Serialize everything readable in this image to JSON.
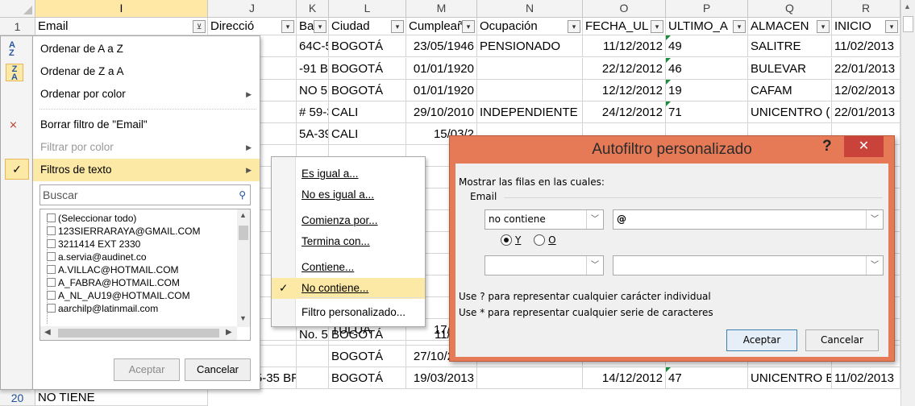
{
  "sheet": {
    "columns": [
      "I",
      "J",
      "K",
      "L",
      "M",
      "N",
      "O",
      "P",
      "Q",
      "R"
    ],
    "selected_column": "I",
    "header_row": {
      "num": "1",
      "cells": [
        "Email",
        "Direcció",
        "Barr",
        "Ciudad",
        "Cumpleañ",
        "Ocupación",
        "FECHA_UL",
        "ULTIMO_A",
        "ALMACEN",
        "INICIO"
      ]
    },
    "rows": [
      {
        "j": "",
        "k": "64C-50 BR",
        "l": "BOGOTÁ",
        "m": "23/05/1946",
        "n": "PENSIONADO",
        "o": "11/12/2012",
        "p": "49",
        "q": "SALITRE",
        "r": "11/02/2013"
      },
      {
        "j": "",
        "k": "-91 BLOC",
        "l": "BOGOTÁ",
        "m": "01/01/1920",
        "n": "",
        "o": "22/12/2012",
        "p": "46",
        "q": "BULEVAR",
        "r": "22/01/2013"
      },
      {
        "j": "",
        "k": "NO 51-45",
        "l": "BOGOTÁ",
        "m": "01/01/1920",
        "n": "",
        "o": "12/12/2012",
        "p": "19",
        "q": "CAFAM",
        "r": "12/02/2013"
      },
      {
        "j": "",
        "k": "# 59-31 bri",
        "l": "CALI",
        "m": "29/10/2010",
        "n": "INDEPENDIENTE",
        "o": "24/12/2012",
        "p": "71",
        "q": "UNICENTRO (",
        "r": "22/01/2013"
      },
      {
        "j": "",
        "k": "5A-39  BRI",
        "l": "CALI",
        "m": "15/03/2",
        "n": "",
        "o": "",
        "p": "",
        "q": "",
        "r": ""
      },
      {
        "j": "",
        "k": "",
        "l": "",
        "m": "05/2",
        "n": "",
        "o": "",
        "p": "",
        "q": "",
        "r": ""
      },
      {
        "j": "",
        "k": "",
        "l": "",
        "m": "07/0",
        "n": "",
        "o": "",
        "p": "",
        "q": "",
        "r": ""
      },
      {
        "j": "",
        "k": "",
        "l": "",
        "m": "05/1",
        "n": "",
        "o": "",
        "p": "",
        "q": "",
        "r": ""
      },
      {
        "j": "",
        "k": "",
        "l": "",
        "m": "08/2",
        "n": "",
        "o": "",
        "p": "",
        "q": "",
        "r": ""
      },
      {
        "j": "",
        "k": "",
        "l": "",
        "m": "07/2",
        "n": "",
        "o": "",
        "p": "",
        "q": "",
        "r": ""
      },
      {
        "j": "",
        "k": "",
        "l": "",
        "m": "01/2",
        "n": "",
        "o": "",
        "p": "",
        "q": "",
        "r": ""
      },
      {
        "j": "",
        "k": "",
        "l": "",
        "m": "05/2",
        "n": "",
        "o": "",
        "p": "",
        "q": "",
        "r": ""
      },
      {
        "j": "",
        "k": "",
        "l": "",
        "m": "12/1",
        "n": "",
        "o": "",
        "p": "",
        "q": "",
        "r": ""
      },
      {
        "j": "",
        "k": "",
        "l": "TULUA",
        "m": "17/12/1",
        "n": "",
        "o": "",
        "p": "",
        "q": "",
        "r": ""
      },
      {
        "j": "",
        "k": "No. 57-71",
        "l": "BOGOTÁ",
        "m": "11/12/2",
        "n": "",
        "o": "",
        "p": "",
        "q": "",
        "r": ""
      },
      {
        "j": "",
        "k": "",
        "l": "BOGOTÁ",
        "m": "27/10/2013",
        "n": "",
        "o": "22/12/2012",
        "p": "47",
        "q": "UNICENTRO B",
        "r": "06/02/2013"
      },
      {
        "j": "K 6 # 125-35 BRR S",
        "k": "",
        "l": "BOGOTÁ",
        "m": "19/03/2013",
        "n": "",
        "o": "14/12/2012",
        "p": "47",
        "q": "UNICENTRO B",
        "r": "11/02/2013"
      }
    ],
    "last_row": {
      "num": "20",
      "email": "NO TIENE"
    }
  },
  "filter_menu": {
    "sort_az": "Ordenar de A a Z",
    "sort_za": "Ordenar de Z a A",
    "sort_color": "Ordenar por color",
    "clear_filter": "Borrar filtro de \"Email\"",
    "filter_color": "Filtrar por color",
    "text_filters": "Filtros de texto",
    "search_placeholder": "Buscar",
    "items": [
      "(Seleccionar todo)",
      "123SIERRARAYA@GMAIL.COM",
      "3211414 EXT 2330",
      "a.servia@audinet.co",
      "A.VILLAC@HOTMAIL.COM",
      "A_FABRA@HOTMAIL.COM",
      "A_NL_AU19@HOTMAIL.COM",
      "aarchilp@latinmail.com"
    ],
    "ok": "Aceptar",
    "cancel": "Cancelar"
  },
  "submenu": {
    "items": [
      "Es igual a...",
      "No es igual a...",
      "Comienza por...",
      "Termina con...",
      "Contiene...",
      "No contiene...",
      "Filtro personalizado..."
    ],
    "checked_index": 5
  },
  "dialog": {
    "title": "Autofiltro personalizado",
    "help": "?",
    "close": "✕",
    "show_rows": "Mostrar las filas en las cuales:",
    "field": "Email",
    "op1": "no contiene",
    "val1": "@",
    "and_label": "Y",
    "or_label": "O",
    "op2": "",
    "val2": "",
    "hint1": "Use ? para representar cualquier carácter individual",
    "hint2": "Use * para representar cualquier serie de caracteres",
    "ok": "Aceptar",
    "cancel": "Cancelar"
  }
}
